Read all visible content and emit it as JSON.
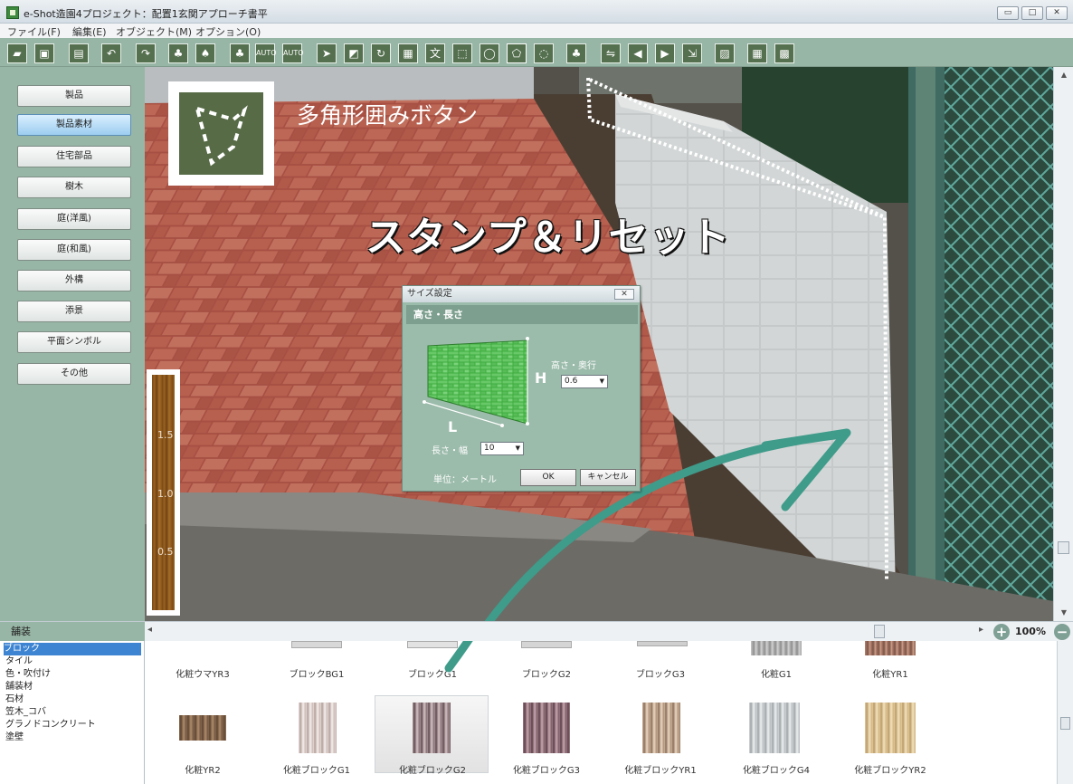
{
  "window": {
    "title": "e-Shot造園4プロジェクト：配置1玄関アプローチ書平",
    "min_label": "▭",
    "max_label": "□",
    "close_label": "✕"
  },
  "menu": [
    "ファイル(F)",
    "編集(E)",
    "オブジェクト(M)",
    "オプション(O)"
  ],
  "toolbar": {
    "icons": [
      "open-icon",
      "save-icon",
      "image-icon",
      "undo-icon",
      "redo-icon",
      "trees-icon",
      "tree-image-icon",
      "forest-icon",
      "auto-horizontal-icon",
      "auto-vertical-icon",
      "select-arrow-icon",
      "rotate-frame-icon",
      "rotate-icon",
      "picture-frame-icon",
      "text-icon",
      "rect-select-icon",
      "ellipse-select-icon",
      "polygon-select-icon",
      "freeform-select-icon",
      "tree-pair-icon",
      "flip-icon",
      "arrow-left-icon",
      "arrow-right-icon",
      "send-icon",
      "hatch-icon",
      "grid-icon",
      "grid-edit-icon"
    ],
    "auto_label": "AUTO",
    "text_tool_label": "文"
  },
  "sidebar": {
    "buttons": [
      "製品",
      "製品素材",
      "住宅部品",
      "樹木",
      "庭(洋風)",
      "庭(和風)",
      "外構",
      "添景",
      "平面シンボル",
      "その他"
    ],
    "active_index": 1
  },
  "overlay": {
    "logo_caption": "多角形囲みボタン",
    "headline": "スタンプ＆リセット"
  },
  "ruler": {
    "marks": [
      "1.5",
      "1.0",
      "0.5"
    ]
  },
  "dialog": {
    "title": "サイズ設定",
    "close": "✕",
    "header": "高さ・長さ",
    "height_depth_label": "高さ・奥行",
    "height_value": "0.6",
    "h_letter": "H",
    "l_letter": "L",
    "length_width_label": "長さ・幅",
    "length_value": "10",
    "unit_label": "単位：メートル",
    "ok": "OK",
    "cancel": "キャンセル"
  },
  "bottom_bar": {
    "label": "舗装",
    "left_arrow": "◂",
    "right_arrow": "▸",
    "zoom": "100%"
  },
  "material_categories": {
    "items": [
      "ブロック",
      "タイル",
      "色・吹付け",
      "舗装材",
      "石材",
      "笠木_コバ",
      "グラノドコンクリート",
      "塗壁"
    ],
    "selected_index": 0
  },
  "materials": {
    "row1": [
      "化粧ウマYR3",
      "ブロックBG1",
      "ブロックG1",
      "ブロックG2",
      "ブロックG3",
      "化粧G1",
      "化粧YR1"
    ],
    "row2": [
      "化粧YR2",
      "化粧ブロックG1",
      "化粧ブロックG2",
      "化粧ブロックG3",
      "化粧ブロックYR1",
      "化粧ブロックG4",
      "化粧ブロックYR2"
    ],
    "selected_row2_index": 2
  },
  "colors": {
    "panel": "#98b6a6",
    "tool_bg": "#55704f",
    "arrow": "#3f9b8a",
    "brick": "#b4574a",
    "dialog_header": "#7d9f8f"
  }
}
